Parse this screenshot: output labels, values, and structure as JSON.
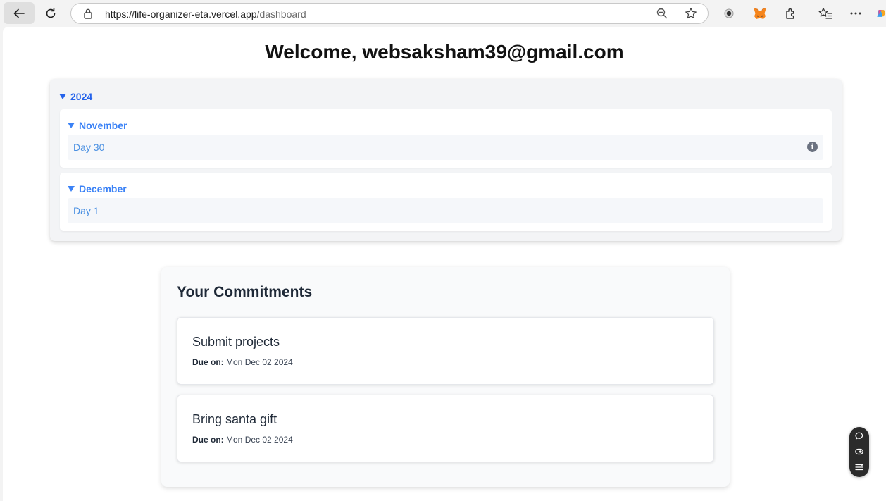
{
  "browser": {
    "url_host": "https://life-organizer-eta.vercel.app",
    "url_path": "/dashboard",
    "colors": {
      "accent": "#2563eb",
      "month": "#3b82f6",
      "day": "#4a90e2"
    }
  },
  "header": {
    "welcome": "Welcome, websaksham39@gmail.com"
  },
  "tree": {
    "year": "2024",
    "months": [
      {
        "label": "November",
        "days": [
          {
            "label": "Day 30",
            "has_info": true
          }
        ]
      },
      {
        "label": "December",
        "days": [
          {
            "label": "Day 1",
            "has_info": false
          }
        ]
      }
    ]
  },
  "commitments": {
    "title": "Your Commitments",
    "due_label": "Due on:",
    "items": [
      {
        "title": "Submit projects",
        "due": "Mon Dec 02 2024"
      },
      {
        "title": "Bring santa gift",
        "due": "Mon Dec 02 2024"
      }
    ]
  }
}
